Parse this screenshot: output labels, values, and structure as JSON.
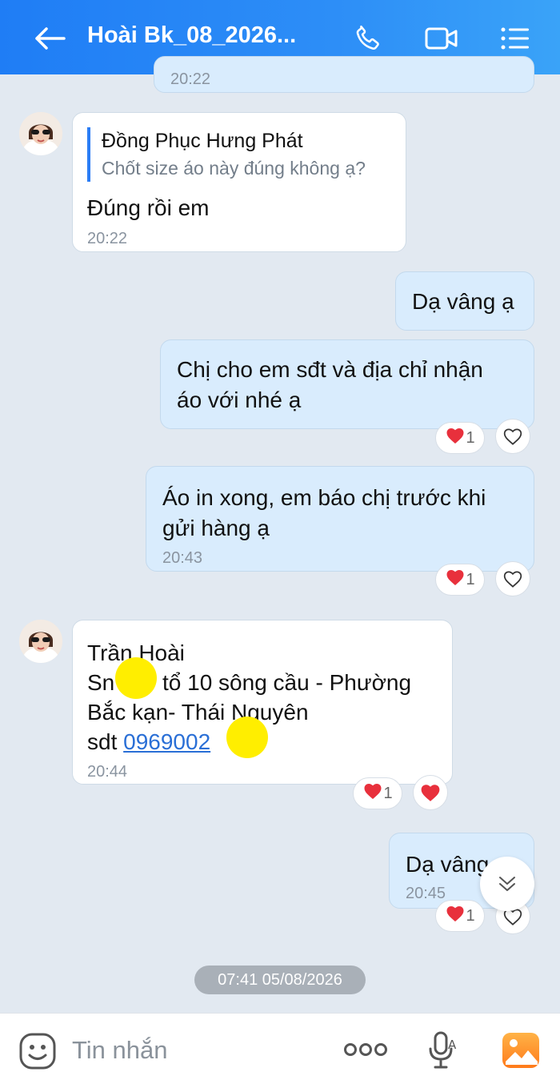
{
  "header": {
    "title": "Hoài Bk_08_2026...",
    "back_icon": "arrow-left-icon",
    "call_icon": "phone-icon",
    "video_icon": "video-camera-icon",
    "menu_icon": "list-menu-icon"
  },
  "messages": [
    {
      "time": "20:22"
    },
    {
      "quote_name": "Đồng Phục Hưng Phát",
      "quote_text": "Chốt size áo này đúng không ạ?",
      "text": "Đúng rồi em",
      "time": "20:22"
    },
    {
      "text": "Dạ vâng ạ"
    },
    {
      "line1": "Chị cho em sđt và địa chỉ nhận",
      "line2": "áo với nhé ạ",
      "reaction_count": "1"
    },
    {
      "line1": "Áo in xong, em báo chị trước khi",
      "line2": "gửi hàng ạ",
      "time": "20:43",
      "reaction_count": "1"
    },
    {
      "line1": "Trần Hoài",
      "line2_a": "Sn",
      "line2_b": "tổ 10 sông cầu - Phường",
      "line3": "Bắc kạn- Thái Nguyên",
      "line4_prefix": "sdt ",
      "phone_link": "0969002",
      "time": "20:44",
      "reaction_count": "1"
    },
    {
      "text": "Dạ vâng",
      "time": "20:45",
      "reaction_count": "1"
    }
  ],
  "date_separator": "07:41 05/08/2026",
  "composer": {
    "placeholder": "Tin nhắn",
    "emoji_icon": "sticker-smile-icon",
    "more_icon": "more-dots-icon",
    "mic_icon": "voice-mic-icon",
    "image_icon": "image-gallery-icon"
  },
  "colors": {
    "header": "#1f7df5",
    "background": "#e2e9f1",
    "outgoing_bubble": "#d9ecfd",
    "heart": "#e8303c"
  }
}
